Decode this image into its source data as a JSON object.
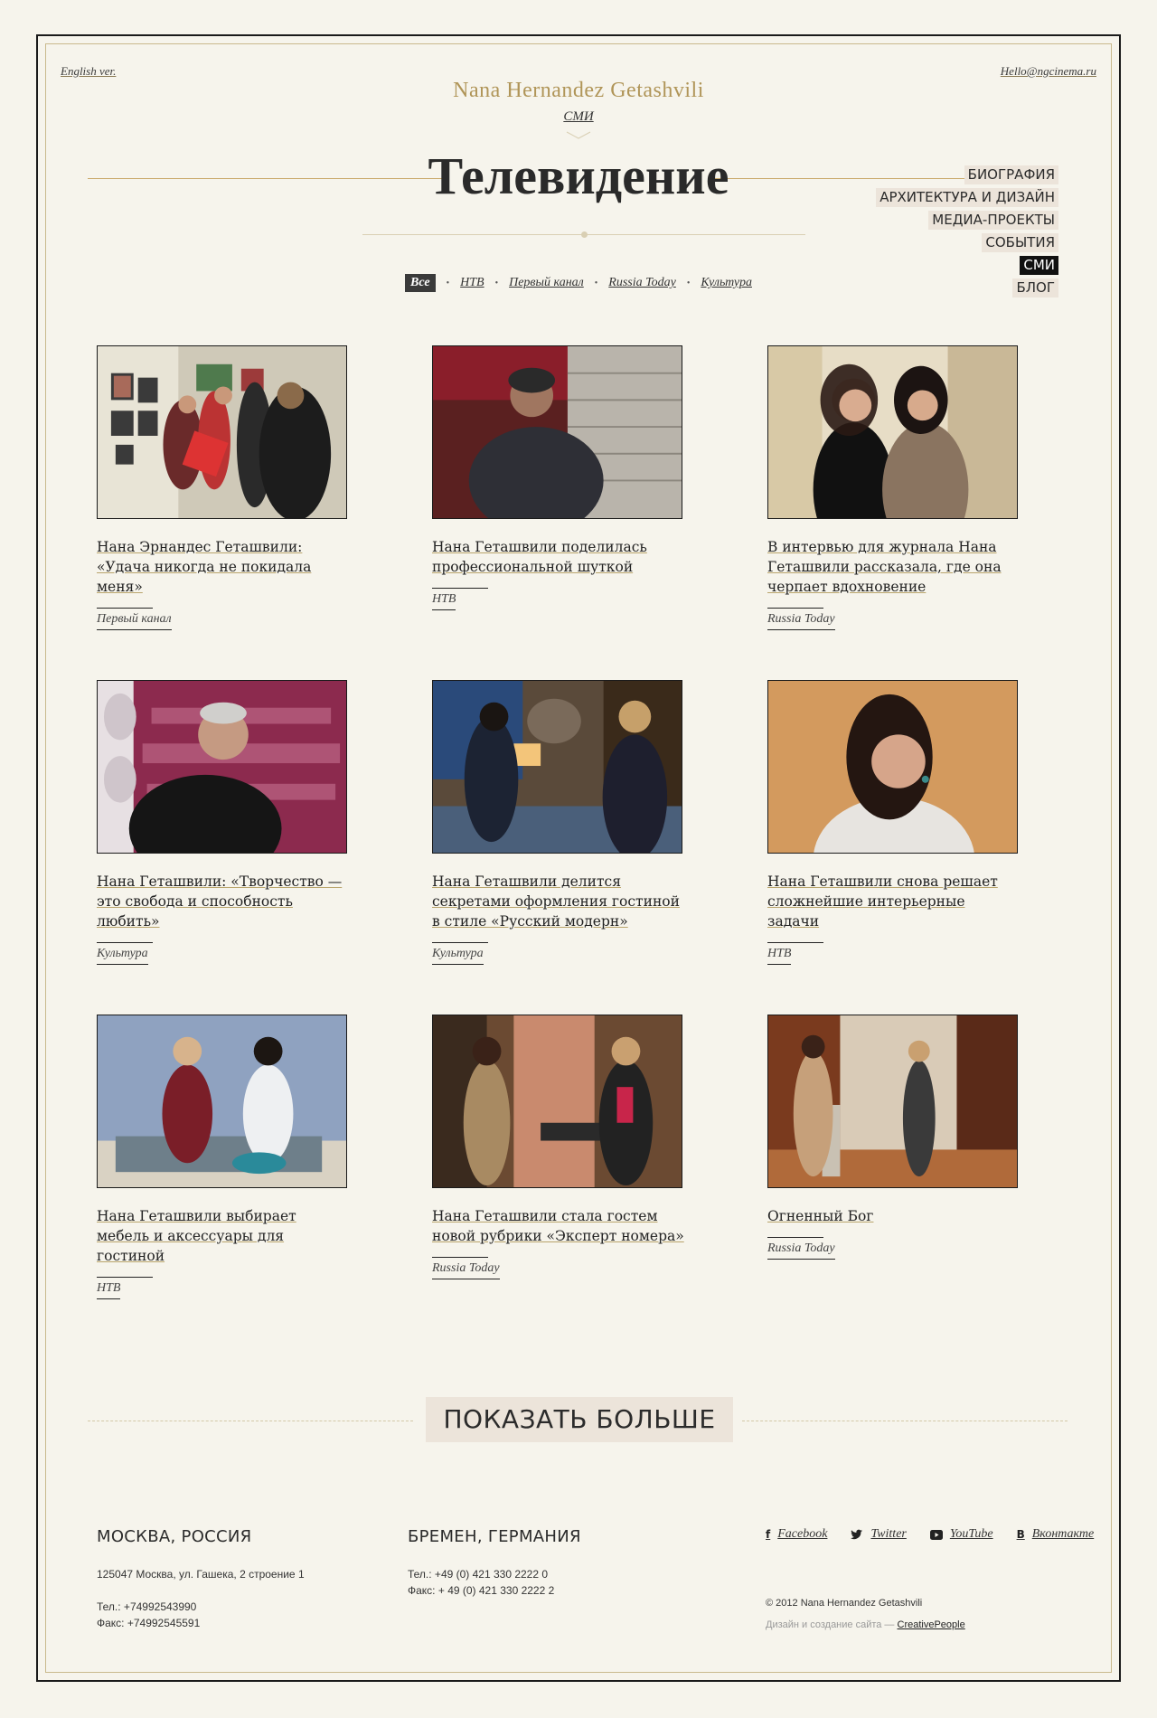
{
  "header": {
    "lang_link": "English ver.",
    "email": "Hello@ngcinema.ru",
    "brand": "Nana Hernandez Getashvili",
    "section": "СМИ",
    "title": "Телевидение"
  },
  "nav": {
    "items": [
      {
        "label": "БИОГРАФИЯ",
        "active": false
      },
      {
        "label": "АРХИТЕКТУРА И ДИЗАЙН",
        "active": false
      },
      {
        "label": "МЕДИА-ПРОЕКТЫ",
        "active": false
      },
      {
        "label": "СОБЫТИЯ",
        "active": false
      },
      {
        "label": "СМИ",
        "active": true
      },
      {
        "label": "БЛОГ",
        "active": false
      }
    ]
  },
  "filters": [
    "Все",
    "НТВ",
    "Первый канал",
    "Russia Today",
    "Культура"
  ],
  "cards": [
    {
      "title": "Нана Эрнандес Геташвили: «Удача никогда не покидала меня»",
      "tag": "Первый канал"
    },
    {
      "title": "Нана Геташвили поделилась профессиональной шуткой",
      "tag": "НТВ"
    },
    {
      "title": "В интервью для журнала Нана Геташвили рассказала, где она черпает вдохновение",
      "tag": "Russia Today"
    },
    {
      "title": "Нана Геташвили: «Творчество — это свобода и способность любить»",
      "tag": "Культура"
    },
    {
      "title": "Нана Геташвили делится секретами оформления гостиной в стиле «Русский модерн»",
      "tag": "Культура"
    },
    {
      "title": "Нана Геташвили снова решает сложнейшие интерьерные задачи",
      "tag": "НТВ"
    },
    {
      "title": "Нана Геташвили выбирает мебель и аксессуары для гостиной",
      "tag": "НТВ"
    },
    {
      "title": "Нана Геташвили стала гостем новой рубрики «Эксперт номера»",
      "tag": "Russia Today"
    },
    {
      "title": "Огненный Бог",
      "tag": "Russia Today"
    }
  ],
  "more_button": "ПОКАЗАТЬ БОЛЬШЕ",
  "footer": {
    "moscow": {
      "city": "МОСКВА, РОССИЯ",
      "address": "125047 Москва, ул. Гашека, 2 строение 1",
      "phone": "Тел.: +74992543990",
      "fax": "Факс: +74992545591"
    },
    "bremen": {
      "city": "БРЕМЕН, ГЕРМАНИЯ",
      "phone": "Тел.: +49 (0) 421 330 2222 0",
      "fax": "Факс: + 49 (0) 421 330 2222 2"
    },
    "social": [
      {
        "icon": "f",
        "label": "Facebook"
      },
      {
        "icon": "twitter-bird",
        "label": "Twitter"
      },
      {
        "icon": "youtube-play",
        "label": "YouTube"
      },
      {
        "icon": "В",
        "label": "Вконтакте"
      }
    ],
    "copyright": "© 2012 Nana Hernandez Getashvili",
    "credit_prefix": "Дизайн и создание сайта — ",
    "credit_link": "CreativePeople"
  }
}
